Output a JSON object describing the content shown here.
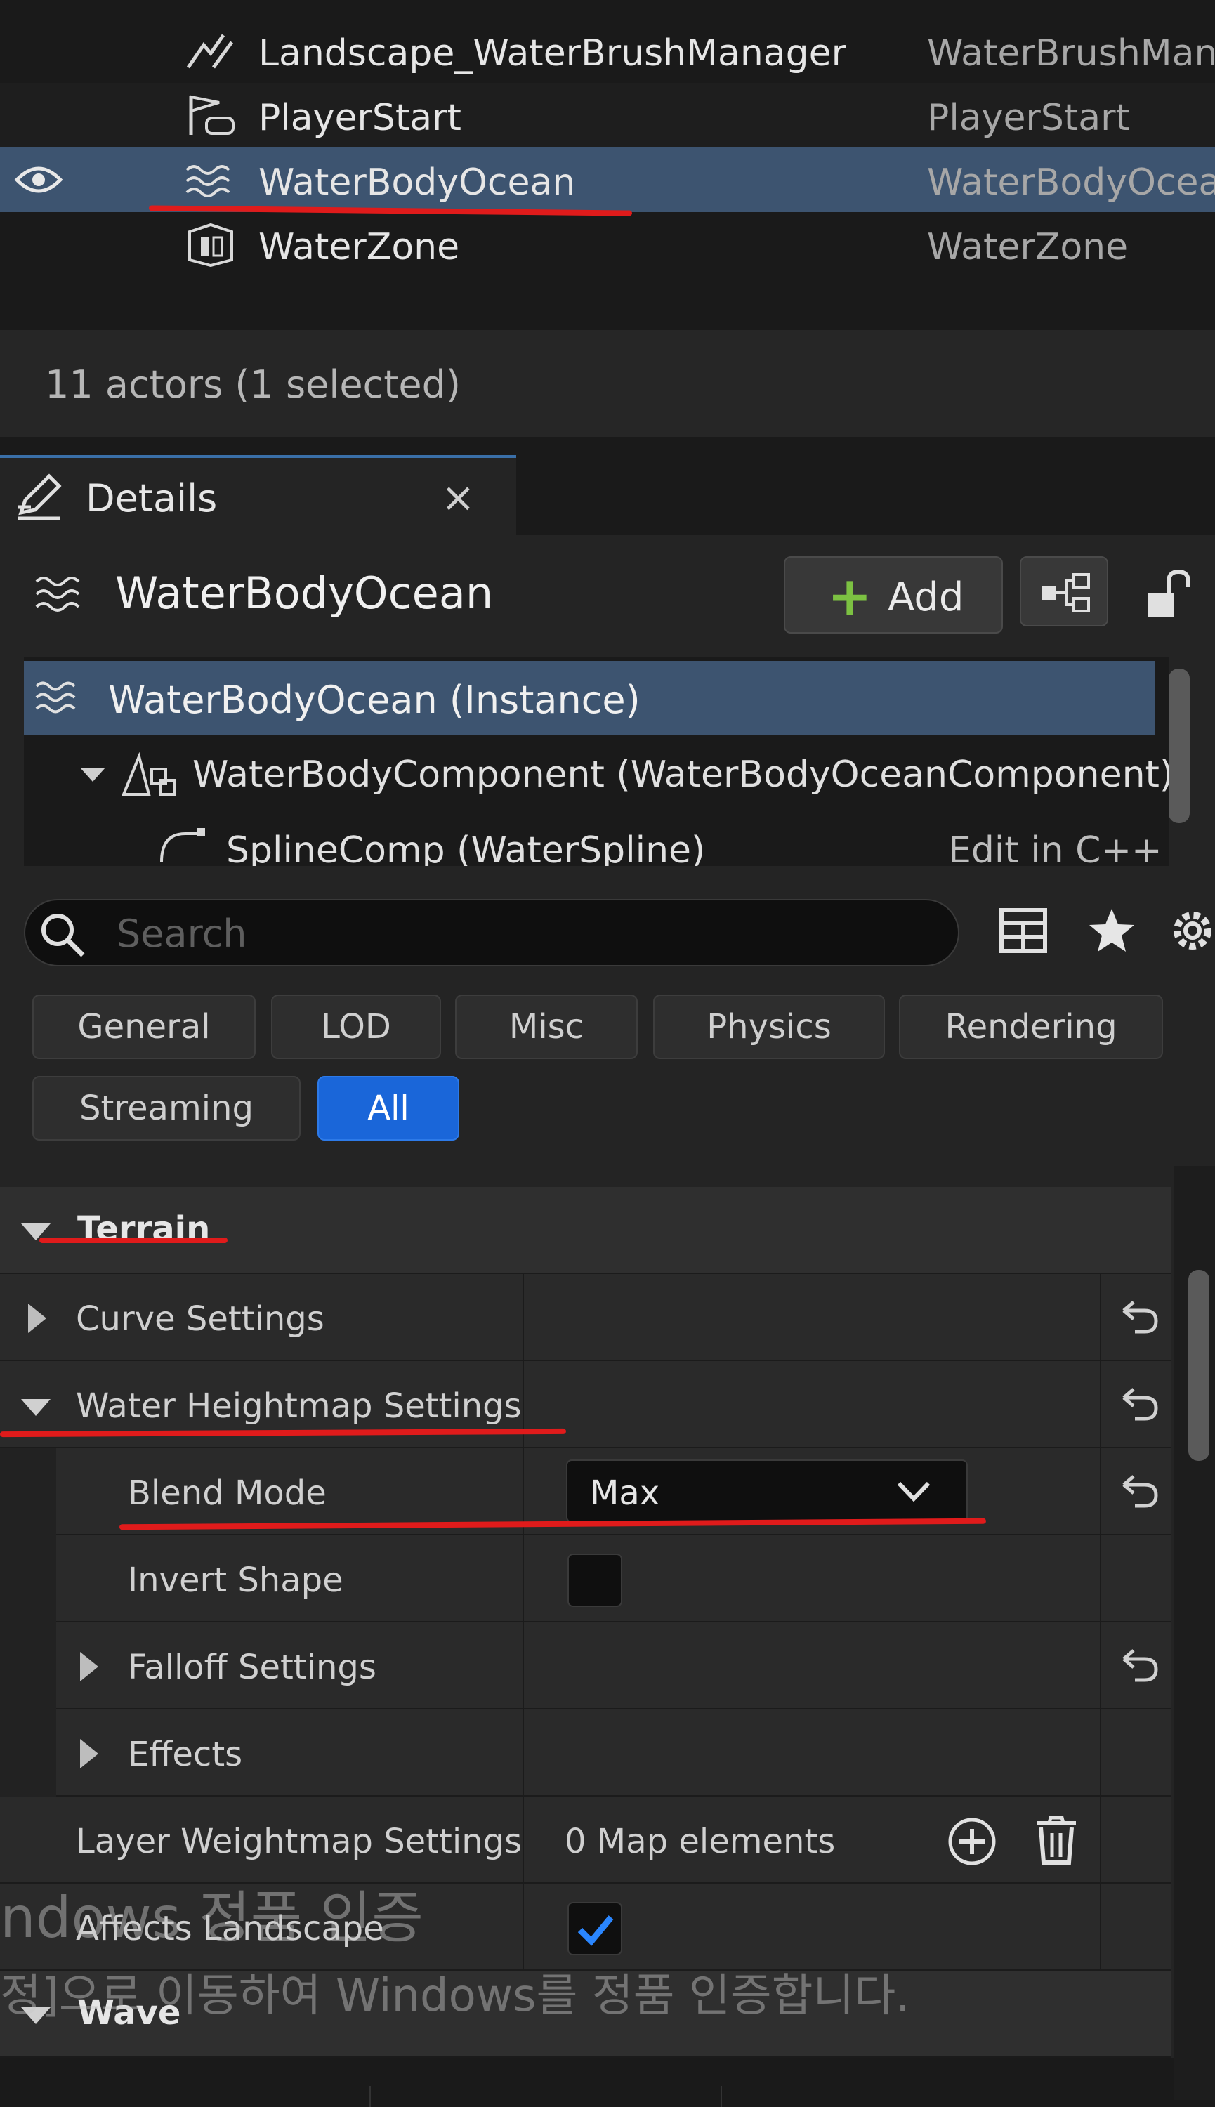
{
  "outliner": {
    "rows": [
      {
        "name": "Landscape_WaterBrushManager",
        "type": "WaterBrushMan",
        "icon": "landscape-brush-icon"
      },
      {
        "name": "PlayerStart",
        "type": "PlayerStart",
        "icon": "player-start-flag-icon"
      },
      {
        "name": "WaterBodyOcean",
        "type": "WaterBodyOcea",
        "icon": "water-waves-icon",
        "selected": true
      },
      {
        "name": "WaterZone",
        "type": "WaterZone",
        "icon": "water-zone-icon"
      }
    ],
    "status": "11 actors (1 selected)"
  },
  "details": {
    "tab_label": "Details",
    "close_glyph": "×",
    "actor_name": "WaterBodyOcean",
    "add_label": "Add",
    "components": [
      {
        "label": "WaterBodyOcean (Instance)",
        "selected": true
      },
      {
        "label": "WaterBodyComponent (WaterBodyOceanComponent)"
      },
      {
        "label": "SplineComp (WaterSpline)",
        "right": "Edit in C++"
      }
    ],
    "search_placeholder": "Search",
    "filters": [
      "General",
      "LOD",
      "Misc",
      "Physics",
      "Rendering",
      "Streaming",
      "All"
    ],
    "active_filter": "All",
    "sections": {
      "terrain": "Terrain",
      "wave": "Wave"
    },
    "properties": {
      "curve_settings": "Curve Settings",
      "water_heightmap_settings": "Water Heightmap Settings",
      "blend_mode_label": "Blend Mode",
      "blend_mode_value": "Max",
      "invert_shape_label": "Invert Shape",
      "invert_shape_checked": false,
      "falloff_settings": "Falloff Settings",
      "effects": "Effects",
      "layer_weightmap_label": "Layer Weightmap Settings",
      "layer_weightmap_value": "0 Map elements",
      "affects_landscape_label": "Affects Landscape",
      "affects_landscape_checked": true
    }
  },
  "watermark": {
    "line1": "ndows 정품 인증",
    "line2": "정]으로 이동하여 Windows를 정품 인증합니다."
  },
  "colors": {
    "selection": "#3d5470",
    "accent_blue": "#1a66d9",
    "add_plus": "#7cc142",
    "annotation_red": "#e01b1b"
  }
}
